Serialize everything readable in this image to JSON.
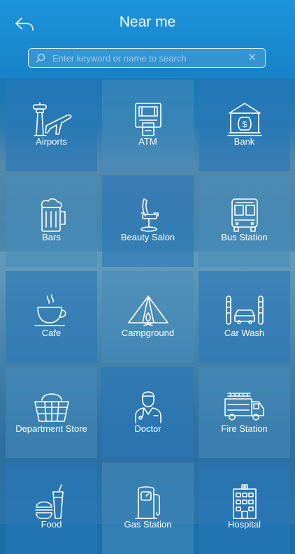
{
  "header": {
    "title": "Near me",
    "back_icon": "back-arrow-icon"
  },
  "search": {
    "placeholder": "Enter keyword or name to search",
    "value": "",
    "search_icon": "search-icon",
    "clear_icon": "clear-icon"
  },
  "categories": [
    {
      "label": "Airports",
      "icon": "airport-icon"
    },
    {
      "label": "ATM",
      "icon": "atm-icon"
    },
    {
      "label": "Bank",
      "icon": "bank-icon"
    },
    {
      "label": "Bars",
      "icon": "beer-mug-icon"
    },
    {
      "label": "Beauty Salon",
      "icon": "salon-chair-icon"
    },
    {
      "label": "Bus Station",
      "icon": "bus-icon"
    },
    {
      "label": "Cafe",
      "icon": "coffee-cup-icon"
    },
    {
      "label": "Campground",
      "icon": "tent-icon"
    },
    {
      "label": "Car Wash",
      "icon": "car-wash-icon"
    },
    {
      "label": "Department Store",
      "icon": "shopping-basket-icon"
    },
    {
      "label": "Doctor",
      "icon": "doctor-icon"
    },
    {
      "label": "Fire Station",
      "icon": "fire-truck-icon"
    },
    {
      "label": "Food",
      "icon": "fast-food-icon"
    },
    {
      "label": "Gas Station",
      "icon": "gas-pump-icon"
    },
    {
      "label": "Hospital",
      "icon": "hospital-icon"
    }
  ],
  "colors": {
    "header": "#1c94dc",
    "tile": "#2878b9",
    "text": "#ffffff"
  }
}
